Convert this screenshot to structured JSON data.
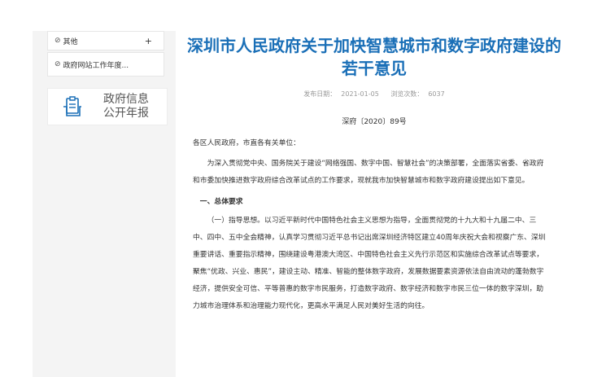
{
  "sidebar": {
    "items": [
      {
        "label": "其他",
        "has_plus": true,
        "plus": "+"
      },
      {
        "label": "政府网站工作年度..."
      }
    ],
    "info_box": {
      "line1": "政府信息",
      "line2": "公开年报"
    }
  },
  "article": {
    "title": "深圳市人民政府关于加快智慧城市和数字政府建设的若干意见",
    "meta": {
      "publish_date_label": "发布日期：",
      "publish_date": "2021-01-05",
      "views_label": "浏览次数：",
      "views": "6037"
    },
    "doc_number": "深府〔2020〕89号",
    "addressee": "各区人民政府，市直各有关单位：",
    "intro": "为深入贯彻党中央、国务院关于建设“网络强国、数字中国、智慧社会”的决策部署，全面落实省委、省政府和市委加快推进数字政府综合改革试点的工作要求，现就我市加快智慧城市和数字政府建设提出如下意见。",
    "section_1_title": "一、总体要求",
    "paragraph_1": "（一）指导思想。以习近平新时代中国特色社会主义思想为指导，全面贯彻党的十九大和十九届二中、三中、四中、五中全会精神，认真学习贯彻习近平总书记出席深圳经济特区建立40周年庆祝大会和视察广东、深圳重要讲话、重要指示精神，围绕建设粤港澳大湾区、中国特色社会主义先行示范区和实施综合改革试点等要求，聚焦“优政、兴业、惠民”，建设主动、精准、智能的整体数字政府，发展数据要素资源依法自由流动的蓬勃数字经济，提供安全可信、平等普惠的数字市民服务，打造数字政府、数字经济和数字市民三位一体的数字深圳，助力城市治理体系和治理能力现代化，更高水平满足人民对美好生活的向往。"
  },
  "colors": {
    "title": "#1a6fb7",
    "background": "#ffffff"
  }
}
